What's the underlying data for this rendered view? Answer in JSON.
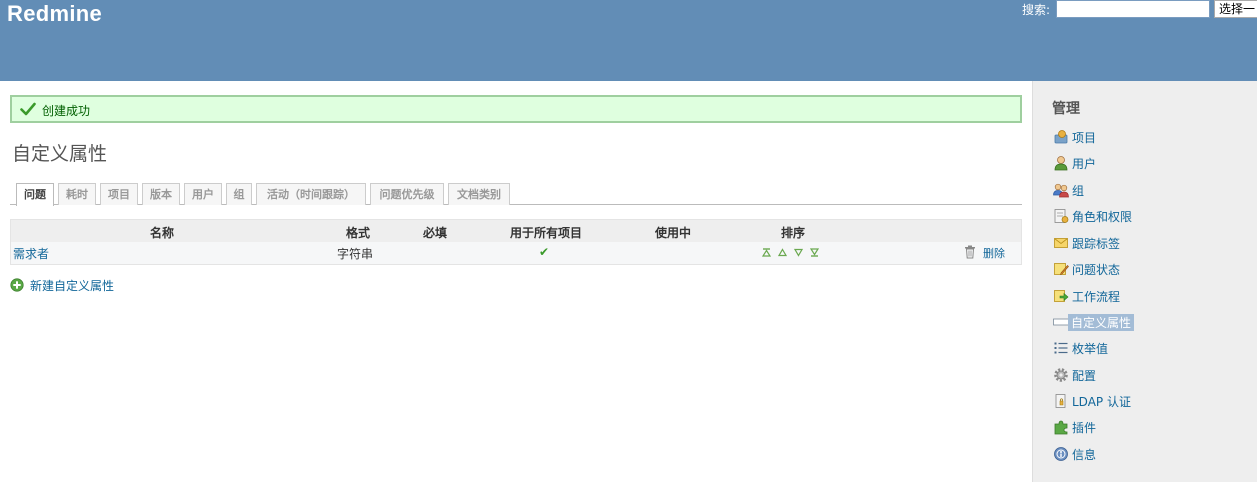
{
  "header": {
    "app_title": "Redmine",
    "search_label": "搜索:",
    "search_value": "",
    "project_jump": "选择一"
  },
  "flash": {
    "message": "创建成功"
  },
  "page_title": "自定义属性",
  "tabs": [
    {
      "label": "问题",
      "selected": true
    },
    {
      "label": "耗时"
    },
    {
      "label": "项目"
    },
    {
      "label": "版本"
    },
    {
      "label": "用户"
    },
    {
      "label": "组"
    },
    {
      "label": "活动（时间跟踪）"
    },
    {
      "label": "问题优先级"
    },
    {
      "label": "文档类别"
    }
  ],
  "table": {
    "columns": [
      "名称",
      "格式",
      "必填",
      "用于所有项目",
      "使用中",
      "排序"
    ],
    "rows": [
      {
        "name": "需求者",
        "format": "字符串",
        "required": "",
        "for_all": "✔",
        "used": "",
        "delete": "删除"
      }
    ]
  },
  "new_link": "新建自定义属性",
  "sidebar": {
    "title": "管理",
    "items": [
      {
        "label": "项目",
        "icon": "projects-icon"
      },
      {
        "label": "用户",
        "icon": "user-icon"
      },
      {
        "label": "组",
        "icon": "group-icon"
      },
      {
        "label": "角色和权限",
        "icon": "roles-icon"
      },
      {
        "label": "跟踪标签",
        "icon": "tracker-icon"
      },
      {
        "label": "问题状态",
        "icon": "issue-status-icon"
      },
      {
        "label": "工作流程",
        "icon": "workflow-icon"
      },
      {
        "label": "自定义属性",
        "icon": "custom-field-icon",
        "selected": true
      },
      {
        "label": "枚举值",
        "icon": "list-icon"
      },
      {
        "label": "配置",
        "icon": "gear-icon"
      },
      {
        "label": "LDAP 认证",
        "icon": "ldap-icon"
      },
      {
        "label": "插件",
        "icon": "plugin-icon"
      },
      {
        "label": "信息",
        "icon": "info-icon"
      }
    ]
  },
  "colors": {
    "header": "#628db6",
    "link": "#116699",
    "flash_bg": "#dfffdf",
    "flash_border": "#9fcf9f",
    "sidebar_bg": "#eeeeee",
    "selected_menu": "#a3bcd6"
  }
}
